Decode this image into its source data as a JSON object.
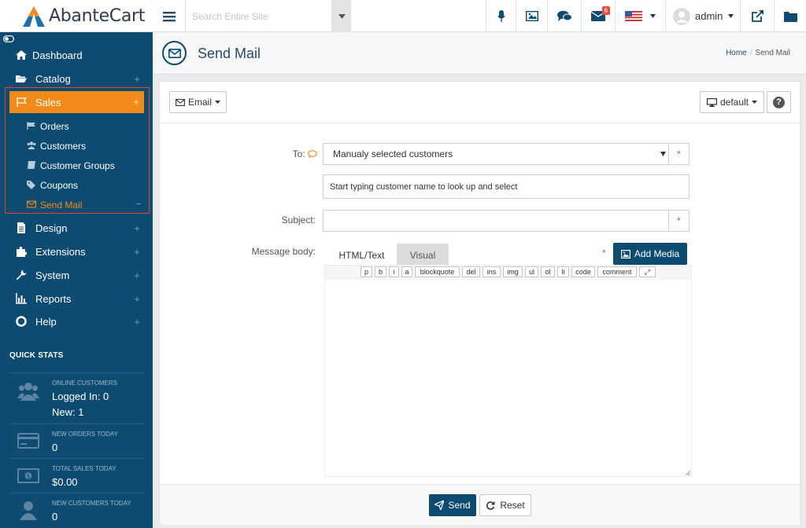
{
  "app": {
    "logo_text": "AbanteCart",
    "search_placeholder": "Search Entire Site",
    "mail_badge": "6",
    "user_name": "admin"
  },
  "sidebar": {
    "items": [
      {
        "label": "Dashboard",
        "icon": "home-icon"
      },
      {
        "label": "Catalog",
        "icon": "folder-open-icon"
      },
      {
        "label": "Sales",
        "icon": "flag-icon"
      },
      {
        "label": "Design",
        "icon": "file-icon"
      },
      {
        "label": "Extensions",
        "icon": "puzzle-icon"
      },
      {
        "label": "System",
        "icon": "wrench-icon"
      },
      {
        "label": "Reports",
        "icon": "bar-chart-icon"
      },
      {
        "label": "Help",
        "icon": "life-ring-icon"
      }
    ],
    "sales_sub": [
      {
        "label": "Orders",
        "icon": "flag-icon"
      },
      {
        "label": "Customers",
        "icon": "users-icon"
      },
      {
        "label": "Customer Groups",
        "icon": "book-icon"
      },
      {
        "label": "Coupons",
        "icon": "tags-icon"
      },
      {
        "label": "Send Mail",
        "icon": "envelope-icon"
      }
    ],
    "plus": "+",
    "minus": "−",
    "quick_stats_title": "QUICK STATS",
    "stats": {
      "online_caption": "ONLINE CUSTOMERS",
      "online_logged": "Logged In: 0",
      "online_new": "New: 1",
      "orders_caption": "NEW ORDERS TODAY",
      "orders_value": "0",
      "sales_caption": "TOTAL SALES TODAY",
      "sales_value": "$0.00",
      "newcust_caption": "NEW CUSTOMERS TODAY",
      "newcust_value": "0"
    }
  },
  "page": {
    "title": "Send Mail",
    "breadcrumb_home": "Home",
    "breadcrumb_current": "Send Mail"
  },
  "toolbar": {
    "email_label": "Email",
    "default_label": "default",
    "help_label": "?"
  },
  "form": {
    "to_label": "To:",
    "to_value": "Manualy selected customers",
    "customer_placeholder": "Start typing customer name to look up and select",
    "subject_label": "Subject:",
    "subject_value": "",
    "body_label": "Message body:",
    "required_mark": "*",
    "tab_html": "HTML/Text",
    "tab_visual": "Visual",
    "add_media": "Add Media",
    "quicktags": [
      "p",
      "b",
      "i",
      "a",
      "blockquote",
      "del",
      "ins",
      "img",
      "ul",
      "ol",
      "li",
      "code",
      "comment",
      "⤢"
    ]
  },
  "footer": {
    "send_label": "Send",
    "reset_label": "Reset"
  },
  "colors": {
    "sidebar": "#0d4b71",
    "accent": "#f28a1a",
    "primary_button": "#0d4b71",
    "required": "#e34c4c"
  }
}
